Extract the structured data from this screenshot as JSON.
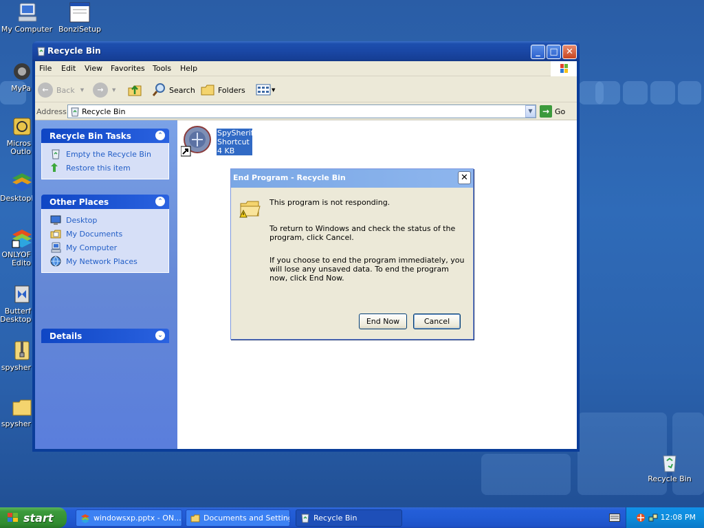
{
  "desktop": {
    "icons": [
      {
        "label": "My Computer"
      },
      {
        "label": "BonziSetup"
      },
      {
        "label": "MyPa"
      },
      {
        "label": "Micros Outlo"
      },
      {
        "label": "Desktopl"
      },
      {
        "label": "ONLYOF Edito"
      },
      {
        "label": "Butterf Desktop"
      },
      {
        "label": "spysher"
      },
      {
        "label": "spysher"
      },
      {
        "label": "Recycle Bin"
      }
    ]
  },
  "window": {
    "title": "Recycle Bin",
    "menu": [
      "File",
      "Edit",
      "View",
      "Favorites",
      "Tools",
      "Help"
    ],
    "toolbar": {
      "back": "Back",
      "search": "Search",
      "folders": "Folders"
    },
    "address": {
      "label": "Address",
      "value": "Recycle Bin",
      "go": "Go"
    },
    "tasks": {
      "title": "Recycle Bin Tasks",
      "items": [
        "Empty the Recycle Bin",
        "Restore this item"
      ]
    },
    "places": {
      "title": "Other Places",
      "items": [
        "Desktop",
        "My Documents",
        "My Computer",
        "My Network Places"
      ]
    },
    "details": {
      "title": "Details"
    },
    "file": {
      "name": "SpySheriff",
      "type": "Shortcut",
      "size": "4 KB"
    }
  },
  "dialog": {
    "title": "End Program - Recycle Bin",
    "line1": "This program is not responding.",
    "line2": "To return to Windows and check the status of the program, click Cancel.",
    "line3": "If you choose to end the program immediately, you will lose any unsaved data. To end the program now, click End Now.",
    "end_now": "End Now",
    "cancel": "Cancel"
  },
  "taskbar": {
    "start": "start",
    "buttons": [
      "windowsxp.pptx - ON...",
      "Documents and Settings",
      "Recycle Bin"
    ],
    "clock": "12:08 PM"
  },
  "colors": {
    "xp_blue": "#0a3d99",
    "selection": "#316ac5",
    "task_link": "#215dc6"
  }
}
